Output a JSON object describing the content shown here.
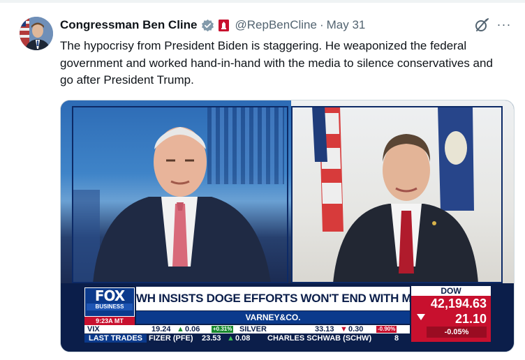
{
  "tweet": {
    "author_name": "Congressman Ben Cline",
    "handle": "@RepBenCline",
    "separator": "·",
    "date": "May 31",
    "more_label": "···",
    "text": "The hypocrisy from President Biden is staggering. He weaponized the federal government and worked hand-in-hand with the media to silence conservatives and go after President Trump.",
    "icons": [
      "verified-badge-icon",
      "government-badge-icon",
      "grok-icon",
      "more-icon"
    ]
  },
  "media": {
    "network_logo": "FOX",
    "network_sub": "BUSINESS",
    "time": "9:23A MT",
    "headline": "WH INSISTS DOGE EFFORTS WON'T END WITH MUSK'S EXIT",
    "show_name": "VARNEY&CO.",
    "dow_label": "DOW",
    "dow_value": "42,194.63",
    "dow_change": "21.10",
    "dow_pct": "-0.05%",
    "ticker_top": {
      "vix_label": "VIX",
      "vix_value": "19.24",
      "vix_change": "0.06",
      "vix_pct": "+0.31%",
      "silver_label": "SILVER",
      "silver_value": "33.13",
      "silver_change": "0.30",
      "silver_pct": "-0.90%"
    },
    "ticker_bottom": {
      "label": "LAST TRADES",
      "pfe": "FIZER (PFE)",
      "pfe_value": "23.53",
      "pfe_change": "0.08",
      "schw": "CHARLES SCHWAB (SCHW)",
      "schw_value": "8"
    }
  },
  "colors": {
    "text_primary": "#0f1419",
    "text_secondary": "#536471",
    "verified": "#829aab",
    "fox_navy": "#0b1e4a",
    "fox_red": "#c8102e"
  }
}
